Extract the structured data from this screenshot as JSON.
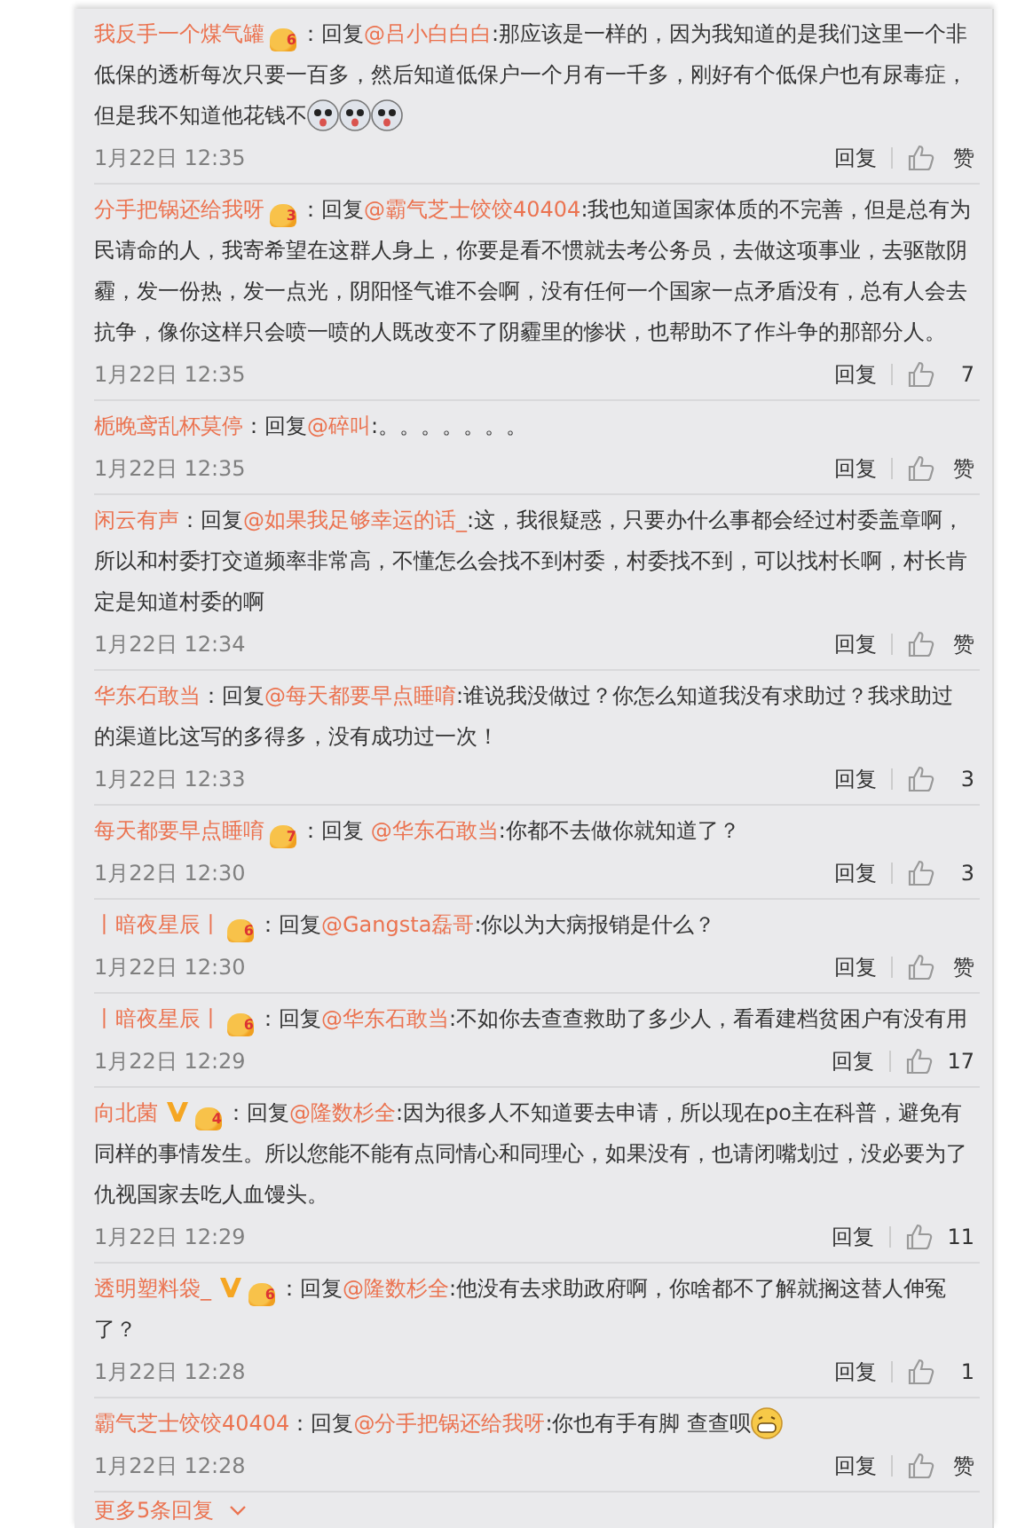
{
  "comments": [
    {
      "user": "我反手一个煤气罐",
      "badge_level": "6",
      "verified": false,
      "reply": "：回复",
      "reply_to": "@吕小白白白",
      "text": ":那应该是一样的，因为我知道的是我们这里一个非低保的透析每次只要一百多，然后知道低保户一个月有一千多，刚好有个低保户也有尿毒症，但是我不知道他花钱不",
      "emojis": [
        {
          "kind": "doge"
        },
        {
          "kind": "doge"
        },
        {
          "kind": "doge"
        }
      ],
      "time": "1月22日 12:35",
      "reply_button": "回复",
      "likes": "赞"
    },
    {
      "user": "分手把锅还给我呀",
      "badge_level": "3",
      "verified": false,
      "reply": "：回复",
      "reply_to": "@霸气芝士饺饺40404",
      "text": ":我也知道国家体质的不完善，但是总有为民请命的人，我寄希望在这群人身上，你要是看不惯就去考公务员，去做这项事业，去驱散阴霾，发一份热，发一点光，阴阳怪气谁不会啊，没有任何一个国家一点矛盾没有，总有人会去抗争，像你这样只会喷一喷的人既改变不了阴霾里的惨状，也帮助不了作斗争的那部分人。",
      "time": "1月22日 12:35",
      "reply_button": "回复",
      "likes": "7"
    },
    {
      "user": "栀晚鸢乱杯莫停",
      "verified": false,
      "reply": "：回复",
      "reply_to": "@碎叫",
      "text": ":。。。。。。。",
      "time": "1月22日 12:35",
      "reply_button": "回复",
      "likes": "赞"
    },
    {
      "user": "闲云有声",
      "verified": false,
      "reply": "：回复",
      "reply_to": "@如果我足够幸运的话_",
      "text": ":这，我很疑惑，只要办什么事都会经过村委盖章啊，所以和村委打交道频率非常高，不懂怎么会找不到村委，村委找不到，可以找村长啊，村长肯定是知道村委的啊",
      "time": "1月22日 12:34",
      "reply_button": "回复",
      "likes": "赞"
    },
    {
      "user": "华东石敢当",
      "verified": false,
      "reply": "：回复",
      "reply_to": "@每天都要早点睡唷",
      "text": ":谁说我没做过？你怎么知道我没有求助过？我求助过的渠道比这写的多得多，没有成功过一次！",
      "time": "1月22日 12:33",
      "reply_button": "回复",
      "likes": "3"
    },
    {
      "user": "每天都要早点睡唷",
      "badge_level": "7",
      "verified": false,
      "reply": "：回复 ",
      "reply_to": "@华东石敢当",
      "text": ":你都不去做你就知道了？",
      "time": "1月22日 12:30",
      "reply_button": "回复",
      "likes": "3"
    },
    {
      "user": "丨暗夜星辰丨",
      "badge_level": "6",
      "verified": false,
      "reply": "：回复",
      "reply_to": "@Gangsta磊哥",
      "text": ":你以为大病报销是什么？",
      "time": "1月22日 12:30",
      "reply_button": "回复",
      "likes": "赞"
    },
    {
      "user": "丨暗夜星辰丨",
      "badge_level": "6",
      "verified": false,
      "reply": "：回复",
      "reply_to": "@华东石敢当",
      "text": ":不如你去查查救助了多少人，看看建档贫困户有没有用",
      "time": "1月22日 12:29",
      "reply_button": "回复",
      "likes": "17"
    },
    {
      "user": "向北菌",
      "badge_level": "4",
      "verified": true,
      "reply": "：回复",
      "reply_to": "@隆数杉全",
      "text": ":因为很多人不知道要去申请，所以现在po主在科普，避免有同样的事情发生。所以您能不能有点同情心和同理心，如果没有，也请闭嘴划过，没必要为了仇视国家去吃人血馒头。",
      "time": "1月22日 12:29",
      "reply_button": "回复",
      "likes": "11"
    },
    {
      "user": "透明塑料袋_",
      "badge_level": "6",
      "verified": true,
      "reply": "：回复",
      "reply_to": "@隆数杉全",
      "text": ":他没有去求助政府啊，你啥都不了解就搁这替人伸冤了？",
      "time": "1月22日 12:28",
      "reply_button": "回复",
      "likes": "1"
    },
    {
      "user": "霸气芝士饺饺40404",
      "verified": false,
      "reply": "：回复",
      "reply_to": "@分手把锅还给我呀",
      "text": ":你也有手有脚 查查呗",
      "emojis": [
        {
          "kind": "grin"
        }
      ],
      "time": "1月22日 12:28",
      "reply_button": "回复",
      "likes": "赞"
    }
  ],
  "more_replies": "更多5条回复"
}
